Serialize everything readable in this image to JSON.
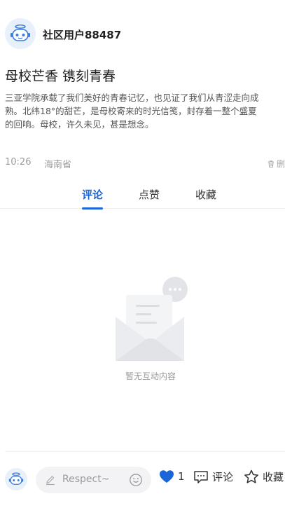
{
  "author": {
    "name": "社区用户88487",
    "avatar_icon": "robot-avatar-icon"
  },
  "post": {
    "title": "母校芒香 镌刻青春",
    "body_lines": [
      "三亚学院承载了我们美好的青春记忆，也见证了我们从青涩走向成",
      "熟。北纬18°的甜芒，是母校寄来的时光信笺，封存着一整个盛夏",
      "的回响。母校，许久未见，甚是想念。"
    ]
  },
  "meta": {
    "time": "10:26",
    "location": "海南省",
    "delete_label": "删除",
    "delete_icon": "trash-icon"
  },
  "tabs": [
    {
      "label": "评论",
      "active": true
    },
    {
      "label": "点赞",
      "active": false
    },
    {
      "label": "收藏",
      "active": false
    }
  ],
  "empty_state": {
    "text": "暂无互动内容",
    "icon": "empty-mail-icon"
  },
  "footer": {
    "input_placeholder": "Respect~",
    "like_count": "1",
    "comment_label": "评论",
    "favorite_label": "收藏"
  },
  "colors": {
    "accent": "#1a66d9",
    "like": "#1a66d9",
    "muted": "#999999"
  }
}
